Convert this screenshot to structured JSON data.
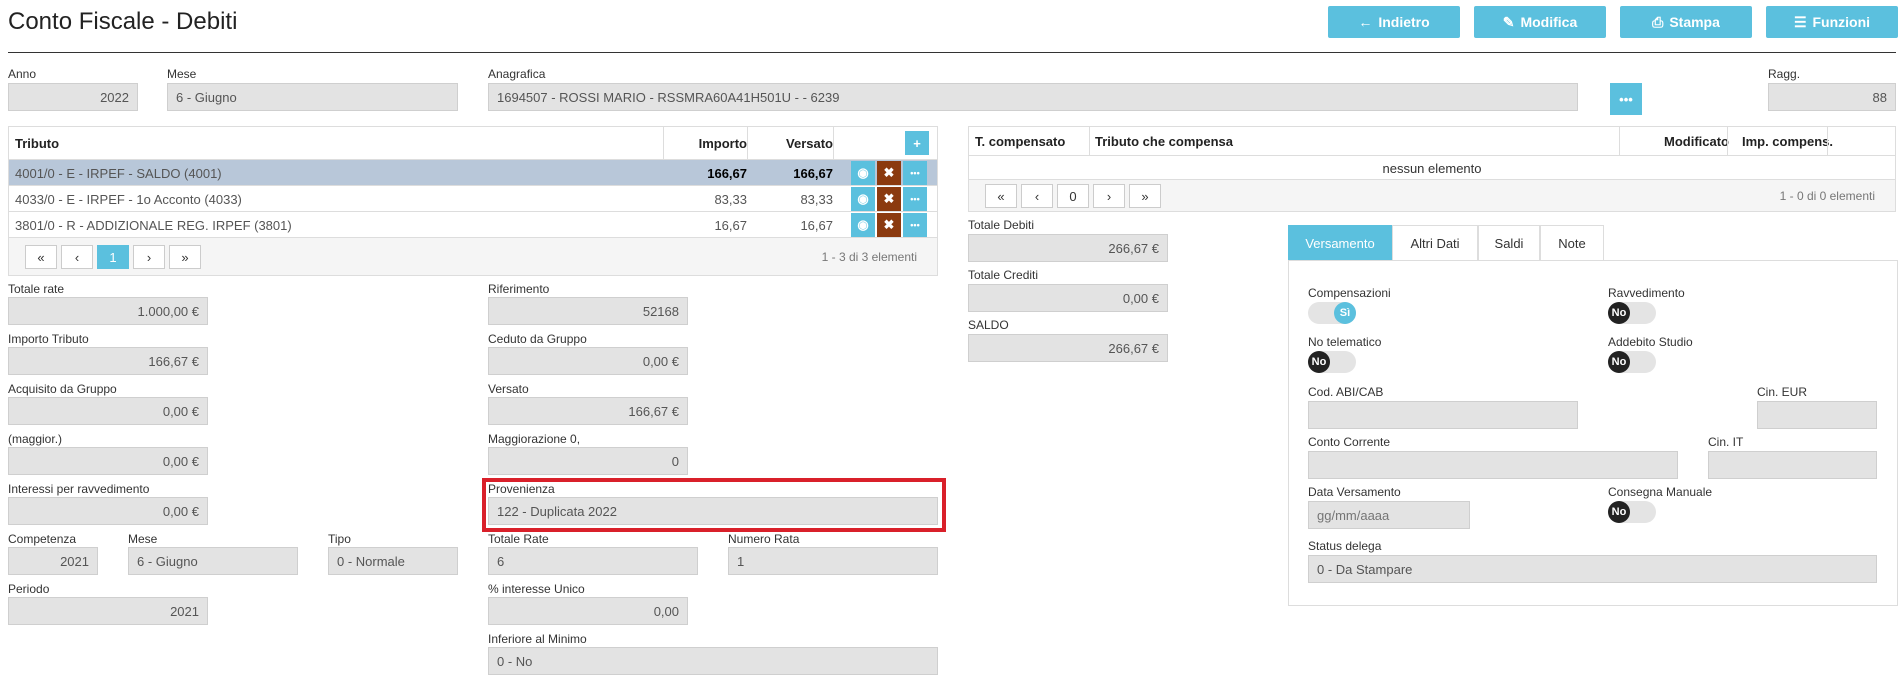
{
  "page": {
    "title": "Conto Fiscale - Debiti"
  },
  "toolbar": {
    "back": "Indietro",
    "edit": "Modifica",
    "print": "Stampa",
    "functions": "Funzioni"
  },
  "top": {
    "anno_label": "Anno",
    "anno": "2022",
    "mese_label": "Mese",
    "mese": "6 - Giugno",
    "anagrafica_label": "Anagrafica",
    "anagrafica": "1694507 - ROSSI MARIO - RSSMRA60A41H501U - - 6239",
    "ragg_label": "Ragg.",
    "ragg": "88"
  },
  "tributi_table": {
    "headers": {
      "tributo": "Tributo",
      "importo": "Importo",
      "versato": "Versato"
    },
    "rows": [
      {
        "tributo": "4001/0 - E - IRPEF - SALDO (4001)",
        "importo": "166,67",
        "versato": "166,67"
      },
      {
        "tributo": "4033/0 - E - IRPEF - 1o Acconto (4033)",
        "importo": "83,33",
        "versato": "83,33"
      },
      {
        "tributo": "3801/0 - R - ADDIZIONALE REG. IRPEF (3801)",
        "importo": "16,67",
        "versato": "16,67"
      }
    ],
    "pager": {
      "first": "«",
      "prev": "‹",
      "page": "1",
      "next": "›",
      "last": "»",
      "info": "1 - 3 di 3 elementi"
    }
  },
  "left_fields": {
    "totale_rate_label": "Totale rate",
    "totale_rate": "1.000,00 €",
    "importo_tributo_label": "Importo Tributo",
    "importo_tributo": "166,67 €",
    "acquisito_label": "Acquisito da Gruppo",
    "acquisito": "0,00 €",
    "maggior_label": "(maggior.)",
    "maggior": "0,00 €",
    "interessi_label": "Interessi per ravvedimento",
    "interessi": "0,00 €",
    "competenza_label": "Competenza",
    "competenza": "2021",
    "mese_label": "Mese",
    "mese": "6 - Giugno",
    "tipo_label": "Tipo",
    "tipo": "0 - Normale",
    "periodo_label": "Periodo",
    "periodo": "2021"
  },
  "mid_fields": {
    "riferimento_label": "Riferimento",
    "riferimento": "52168",
    "ceduto_label": "Ceduto da Gruppo",
    "ceduto": "0,00 €",
    "versato_label": "Versato",
    "versato": "166,67 €",
    "maggiorazione_label": "Maggiorazione 0,",
    "maggiorazione": "0",
    "provenienza_label": "Provenienza",
    "provenienza": "122 - Duplicata 2022",
    "totale_rate_label": "Totale Rate",
    "totale_rate": "6",
    "numero_rata_label": "Numero Rata",
    "numero_rata": "1",
    "interesse_unico_label": "% interesse Unico",
    "interesse_unico": "0,00",
    "inferiore_label": "Inferiore al Minimo",
    "inferiore": "0 - No"
  },
  "comp_table": {
    "headers": {
      "t_comp": "T. compensato",
      "tributo": "Tributo che compensa",
      "modificato": "Modificato",
      "imp": "Imp. compens."
    },
    "empty": "nessun elemento",
    "pager": {
      "first": "«",
      "prev": "‹",
      "page": "0",
      "next": "›",
      "last": "»",
      "info": "1 - 0 di 0 elementi"
    }
  },
  "totals": {
    "debiti_label": "Totale Debiti",
    "debiti": "266,67 €",
    "crediti_label": "Totale Crediti",
    "crediti": "0,00 €",
    "saldo_label": "SALDO",
    "saldo": "266,67 €"
  },
  "tabs": [
    "Versamento",
    "Altri Dati",
    "Saldi",
    "Note"
  ],
  "versamento": {
    "compensazioni_label": "Compensazioni",
    "compensazioni": "Sì",
    "ravvedimento_label": "Ravvedimento",
    "ravvedimento": "No",
    "no_telematico_label": "No telematico",
    "no_telematico": "No",
    "addebito_label": "Addebito Studio",
    "addebito": "No",
    "abi_label": "Cod. ABI/CAB",
    "cin_eur_label": "Cin. EUR",
    "conto_label": "Conto Corrente",
    "cin_it_label": "Cin. IT",
    "data_label": "Data Versamento",
    "data_placeholder": "gg/mm/aaaa",
    "consegna_label": "Consegna Manuale",
    "consegna": "No",
    "status_label": "Status delega",
    "status": "0 - Da Stampare"
  },
  "colors": {
    "accent": "#5bc0de",
    "danger": "#8b3a0f",
    "highlight": "#d9202a",
    "selected_row": "#b8c7d9"
  }
}
